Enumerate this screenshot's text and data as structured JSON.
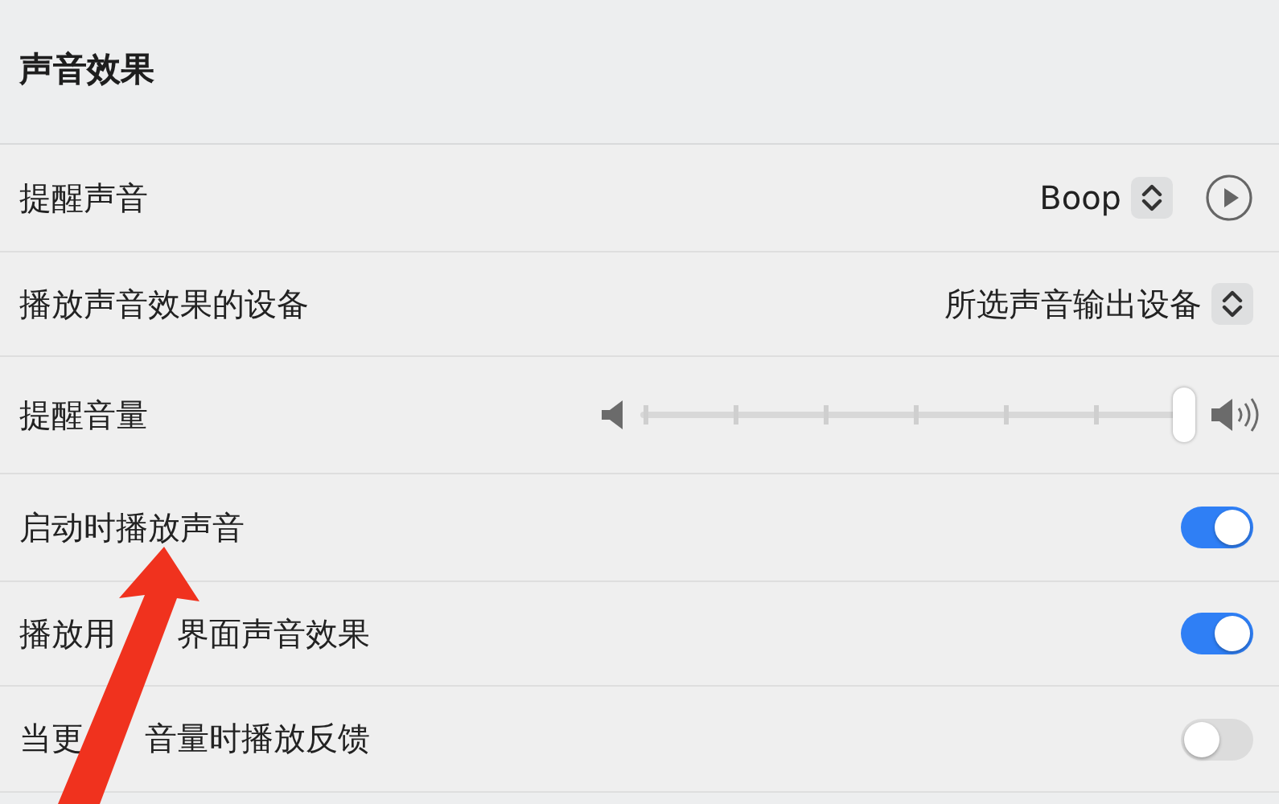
{
  "section_title": "声音效果",
  "rows": [
    {
      "kind": "popup",
      "label_parts": [
        "提醒声音"
      ],
      "value": "Boop",
      "play_button": true
    },
    {
      "kind": "popup",
      "label_parts": [
        "播放声音效果的设备"
      ],
      "value": "所选声音输出设备",
      "play_button": false
    },
    {
      "kind": "slider",
      "label_parts": [
        "提醒音量"
      ],
      "level": 1.0
    },
    {
      "kind": "toggle",
      "label_parts": [
        "启动时播放声音"
      ],
      "on": true
    },
    {
      "kind": "toggle",
      "label_parts": [
        "播放用",
        "界面声音效果"
      ],
      "on": true
    },
    {
      "kind": "toggle",
      "label_parts": [
        "当更",
        "音量时播放反馈"
      ],
      "on": false
    }
  ]
}
